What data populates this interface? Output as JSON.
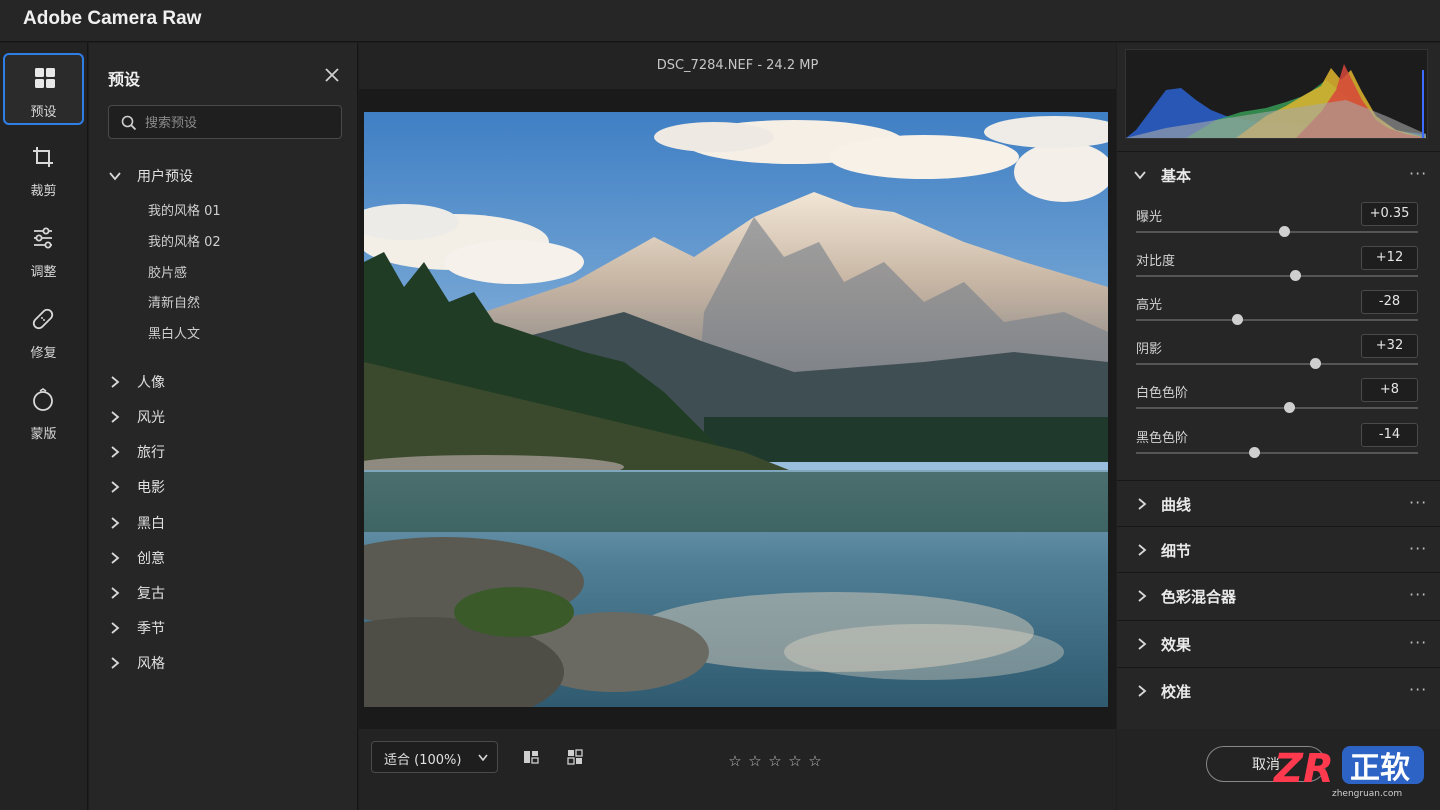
{
  "app": {
    "title": "Adobe Camera Raw"
  },
  "rail": {
    "items": [
      {
        "label": "预设",
        "icon": "grid-icon",
        "active": true
      },
      {
        "label": "裁剪",
        "icon": "crop-icon"
      },
      {
        "label": "调整",
        "icon": "sliders-icon"
      },
      {
        "label": "修复",
        "icon": "bandage-icon"
      },
      {
        "label": "蒙版",
        "icon": "mask-icon"
      }
    ]
  },
  "presets": {
    "title": "预设",
    "search_placeholder": "搜索预设",
    "user_group": {
      "label": "用户预设",
      "items": [
        "我的风格 01",
        "我的风格 02",
        "胶片感",
        "清新自然",
        "黑白人文"
      ]
    },
    "groups": [
      "人像",
      "风光",
      "旅行",
      "电影",
      "黑白",
      "创意",
      "复古",
      "季节",
      "风格"
    ]
  },
  "viewer": {
    "file_info": "DSC_7284.NEF  -  24.2 MP",
    "zoom_label": "适合 (100%)",
    "rating_stars": [
      "☆",
      "☆",
      "☆",
      "☆",
      "☆"
    ]
  },
  "basic": {
    "title": "基本",
    "adjustments": [
      {
        "label": "曝光",
        "value": "+0.35",
        "pos": 0.525
      },
      {
        "label": "对比度",
        "value": "+12",
        "pos": 0.565
      },
      {
        "label": "高光",
        "value": "-28",
        "pos": 0.36
      },
      {
        "label": "阴影",
        "value": "+32",
        "pos": 0.635
      },
      {
        "label": "白色色阶",
        "value": "+8",
        "pos": 0.545
      },
      {
        "label": "黑色色阶",
        "value": "-14",
        "pos": 0.42
      }
    ]
  },
  "sections": [
    "曲线",
    "细节",
    "色彩混合器",
    "效果",
    "校准"
  ],
  "footer": {
    "cancel_label": "取消"
  },
  "watermark": {
    "logo": "ZR",
    "text": "正软",
    "url": "zhengruan.com"
  },
  "colors": {
    "accent": "#2f7ee6",
    "panel": "#262626",
    "background": "#1e1e1e"
  }
}
